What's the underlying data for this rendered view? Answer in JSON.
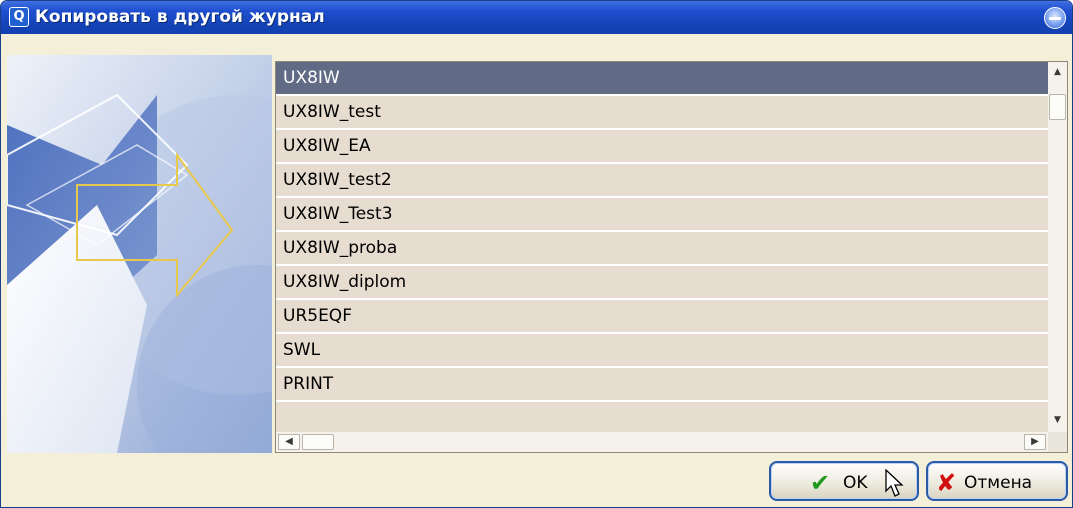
{
  "window": {
    "title": "Копировать в другой журнал",
    "app_icon_glyph": "Q",
    "icons": [
      "app-icon",
      "roll-up-icon"
    ]
  },
  "journal_list": {
    "selected_index": 0,
    "items": [
      "UX8IW",
      "UX8IW_test",
      "UX8IW_EA",
      "UX8IW_test2",
      "UX8IW_Test3",
      "UX8IW_proba",
      "UX8IW_diplom",
      "UR5EQF",
      "SWL",
      "PRINT"
    ]
  },
  "scrollbars": {
    "vertical": {
      "up_glyph": "▲",
      "down_glyph": "▼"
    },
    "horizontal": {
      "left_glyph": "◀",
      "right_glyph": "▶"
    }
  },
  "buttons": {
    "ok": {
      "label": "OK",
      "icon": "check-icon",
      "icon_glyph": "✔"
    },
    "cancel": {
      "label": "Отмена",
      "icon": "cross-icon",
      "icon_glyph": "✘"
    }
  },
  "colors": {
    "titlebar": "#1f4fcf",
    "selection": "#616b86",
    "list_background": "#e6ddd0",
    "dialog_background": "#f4efd9",
    "ok_icon": "#1f9a1f",
    "cancel_icon": "#d01010"
  }
}
